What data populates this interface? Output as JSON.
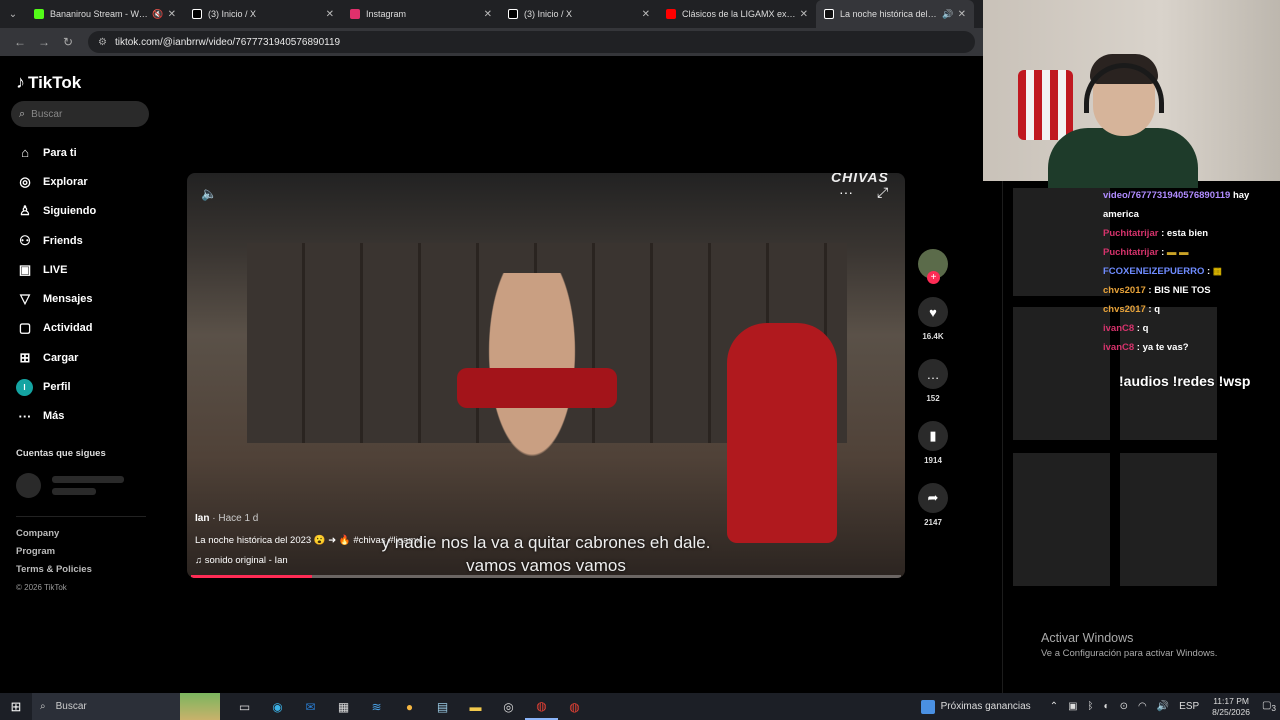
{
  "browser": {
    "tabs": [
      {
        "title": "Bananirou Stream - Watch",
        "favicon_color": "#53fc18",
        "extra": "mute"
      },
      {
        "title": "(3) Inicio / X",
        "favicon_color": "#ffffff",
        "extra": ""
      },
      {
        "title": "Instagram",
        "favicon_color": "#e1306c",
        "extra": ""
      },
      {
        "title": "(3) Inicio / X",
        "favicon_color": "#ffffff",
        "extra": ""
      },
      {
        "title": "Clásicos de la LIGAMX explicad",
        "favicon_color": "#ff0000",
        "extra": ""
      },
      {
        "title": "La noche histórica del 2023",
        "favicon_color": "#ffffff",
        "extra": "audio"
      }
    ],
    "url": "tiktok.com/@ianbrrw/video/7677731940576890119"
  },
  "tiktok": {
    "logo": "TikTok",
    "search_placeholder": "Buscar",
    "menu": [
      {
        "label": "Para ti",
        "icon": "home-icon"
      },
      {
        "label": "Explorar",
        "icon": "compass-icon"
      },
      {
        "label": "Siguiendo",
        "icon": "following-icon"
      },
      {
        "label": "Friends",
        "icon": "friends-icon"
      },
      {
        "label": "LIVE",
        "icon": "live-icon"
      },
      {
        "label": "Mensajes",
        "icon": "messages-icon"
      },
      {
        "label": "Actividad",
        "icon": "activity-icon"
      },
      {
        "label": "Cargar",
        "icon": "upload-icon"
      },
      {
        "label": "Perfil",
        "icon": "profile-avatar"
      },
      {
        "label": "Más",
        "icon": "more-icon"
      }
    ],
    "profile_initial": "I",
    "following_heading": "Cuentas que sigues",
    "footer": {
      "company": "Company",
      "program": "Program",
      "terms": "Terms & Policies",
      "copyright": "© 2026 TikTok"
    },
    "video": {
      "overlay_text": "CHIVAS",
      "author": "Ian",
      "time_ago": "· Hace 1 d",
      "caption": "La noche histórica del 2023 😮 ➜ 🔥 #chivas #ligamx",
      "sound": "sonido original - Ian",
      "subtitle_line1": "y nadie nos la va a quitar cabrones eh dale.",
      "subtitle_line2": "vamos vamos vamos",
      "progress": 0.17
    },
    "actions": {
      "likes": "16.4K",
      "comments": "152",
      "saves": "1914",
      "shares": "2147"
    }
  },
  "stream": {
    "chat": [
      {
        "user": "video/7677731940576890119",
        "message": "hay america",
        "color": "purple"
      },
      {
        "user": "Puchitatrijar",
        "message": "esta bien",
        "color": "pink"
      },
      {
        "user": "Puchitatrijar",
        "message": "▬ ▬",
        "color": "pink"
      },
      {
        "user": "FCOXENEIZEPUERRO",
        "message": "▦",
        "color": "blue"
      },
      {
        "user": "chvs2017",
        "message": "BIS NIE TOS",
        "color": "orange"
      },
      {
        "user": "chvs2017",
        "message": "q",
        "color": "orange"
      },
      {
        "user": "ivanC8",
        "message": "q",
        "color": "pink"
      },
      {
        "user": "ivanC8",
        "message": "ya te vas?",
        "color": "pink"
      }
    ],
    "commands": "!audios !redes !wsp",
    "activate_title": "Activar Windows",
    "activate_sub": "Ve a Configuración para activar Windows."
  },
  "taskbar": {
    "search_label": "Buscar",
    "news": "Próximas ganancias",
    "lang": "ESP",
    "time": "11:17 PM",
    "date": "8/25/2026",
    "notifications": "3"
  }
}
